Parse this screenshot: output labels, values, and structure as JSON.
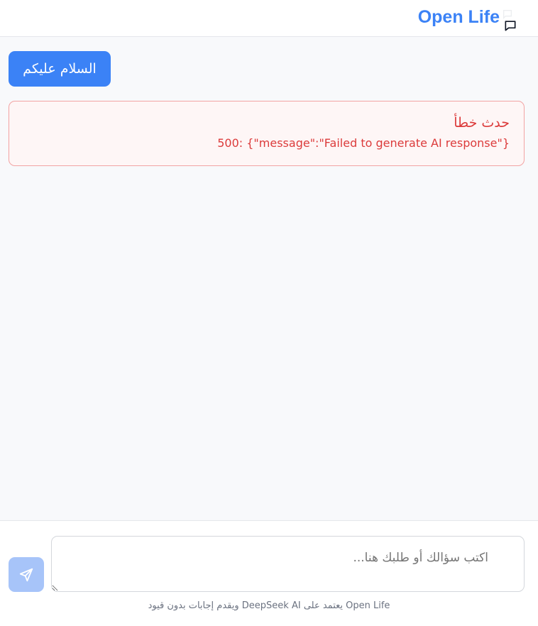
{
  "header": {
    "brand": "Open Life",
    "icon": "message-square-icon"
  },
  "conversation": {
    "user_message": "السلام عليكم",
    "error": {
      "title": "حدث خطأ",
      "detail": "500: {\"message\":\"Failed to generate AI response\"}"
    }
  },
  "composer": {
    "placeholder": "اكتب سؤالك أو طلبك هنا...",
    "send_icon": "send-icon",
    "note": "Open Life يعتمد على DeepSeek AI ويقدم إجابات بدون قيود"
  },
  "colors": {
    "accent": "#3b82f6",
    "error": "#dc3b3b",
    "send_disabled": "#a7c4f9"
  }
}
